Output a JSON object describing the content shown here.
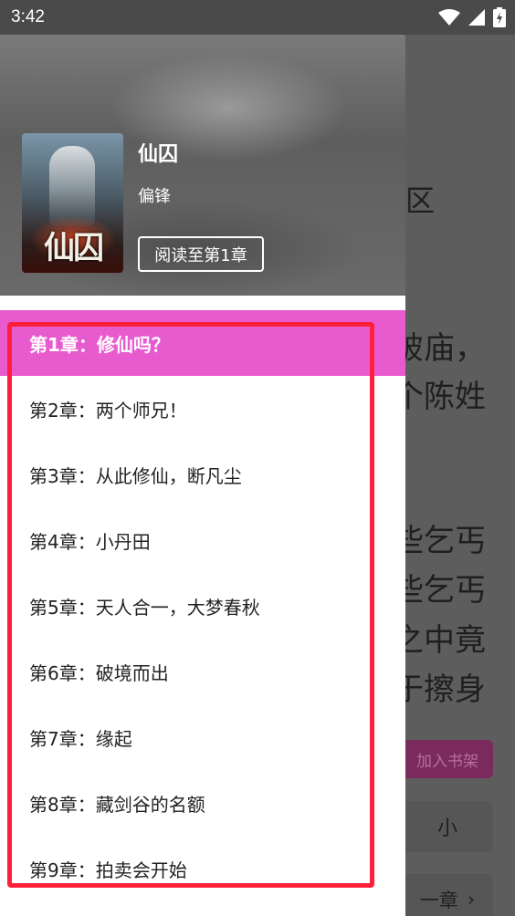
{
  "status_bar": {
    "time": "3:42"
  },
  "reader_background": {
    "title_fragment": "区",
    "lines": [
      "破庙，",
      "个陈姓",
      "些乞丐",
      "些乞丐",
      "之中竟",
      "于擦身"
    ],
    "add_shelf_label": "加入书架",
    "font_small_label": "小",
    "next_chapter_label": "一章"
  },
  "book": {
    "title": "仙囚",
    "author": "偏锋",
    "read_progress_label": "阅读至第1章",
    "cover_text": "仙囚"
  },
  "chapters": [
    {
      "label": "第1章：修仙吗？",
      "active": true
    },
    {
      "label": "第2章：两个师兄！",
      "active": false
    },
    {
      "label": "第3章：从此修仙，断凡尘",
      "active": false
    },
    {
      "label": "第4章：小丹田",
      "active": false
    },
    {
      "label": "第5章：天人合一，大梦春秋",
      "active": false
    },
    {
      "label": "第6章：破境而出",
      "active": false
    },
    {
      "label": "第7章：缘起",
      "active": false
    },
    {
      "label": "第8章：藏剑谷的名额",
      "active": false
    },
    {
      "label": "第9章：拍卖会开始",
      "active": false
    }
  ],
  "colors": {
    "accent": "#e85bcf",
    "highlight_border": "#ff1f3a",
    "scrim": "#5d5d5d"
  }
}
